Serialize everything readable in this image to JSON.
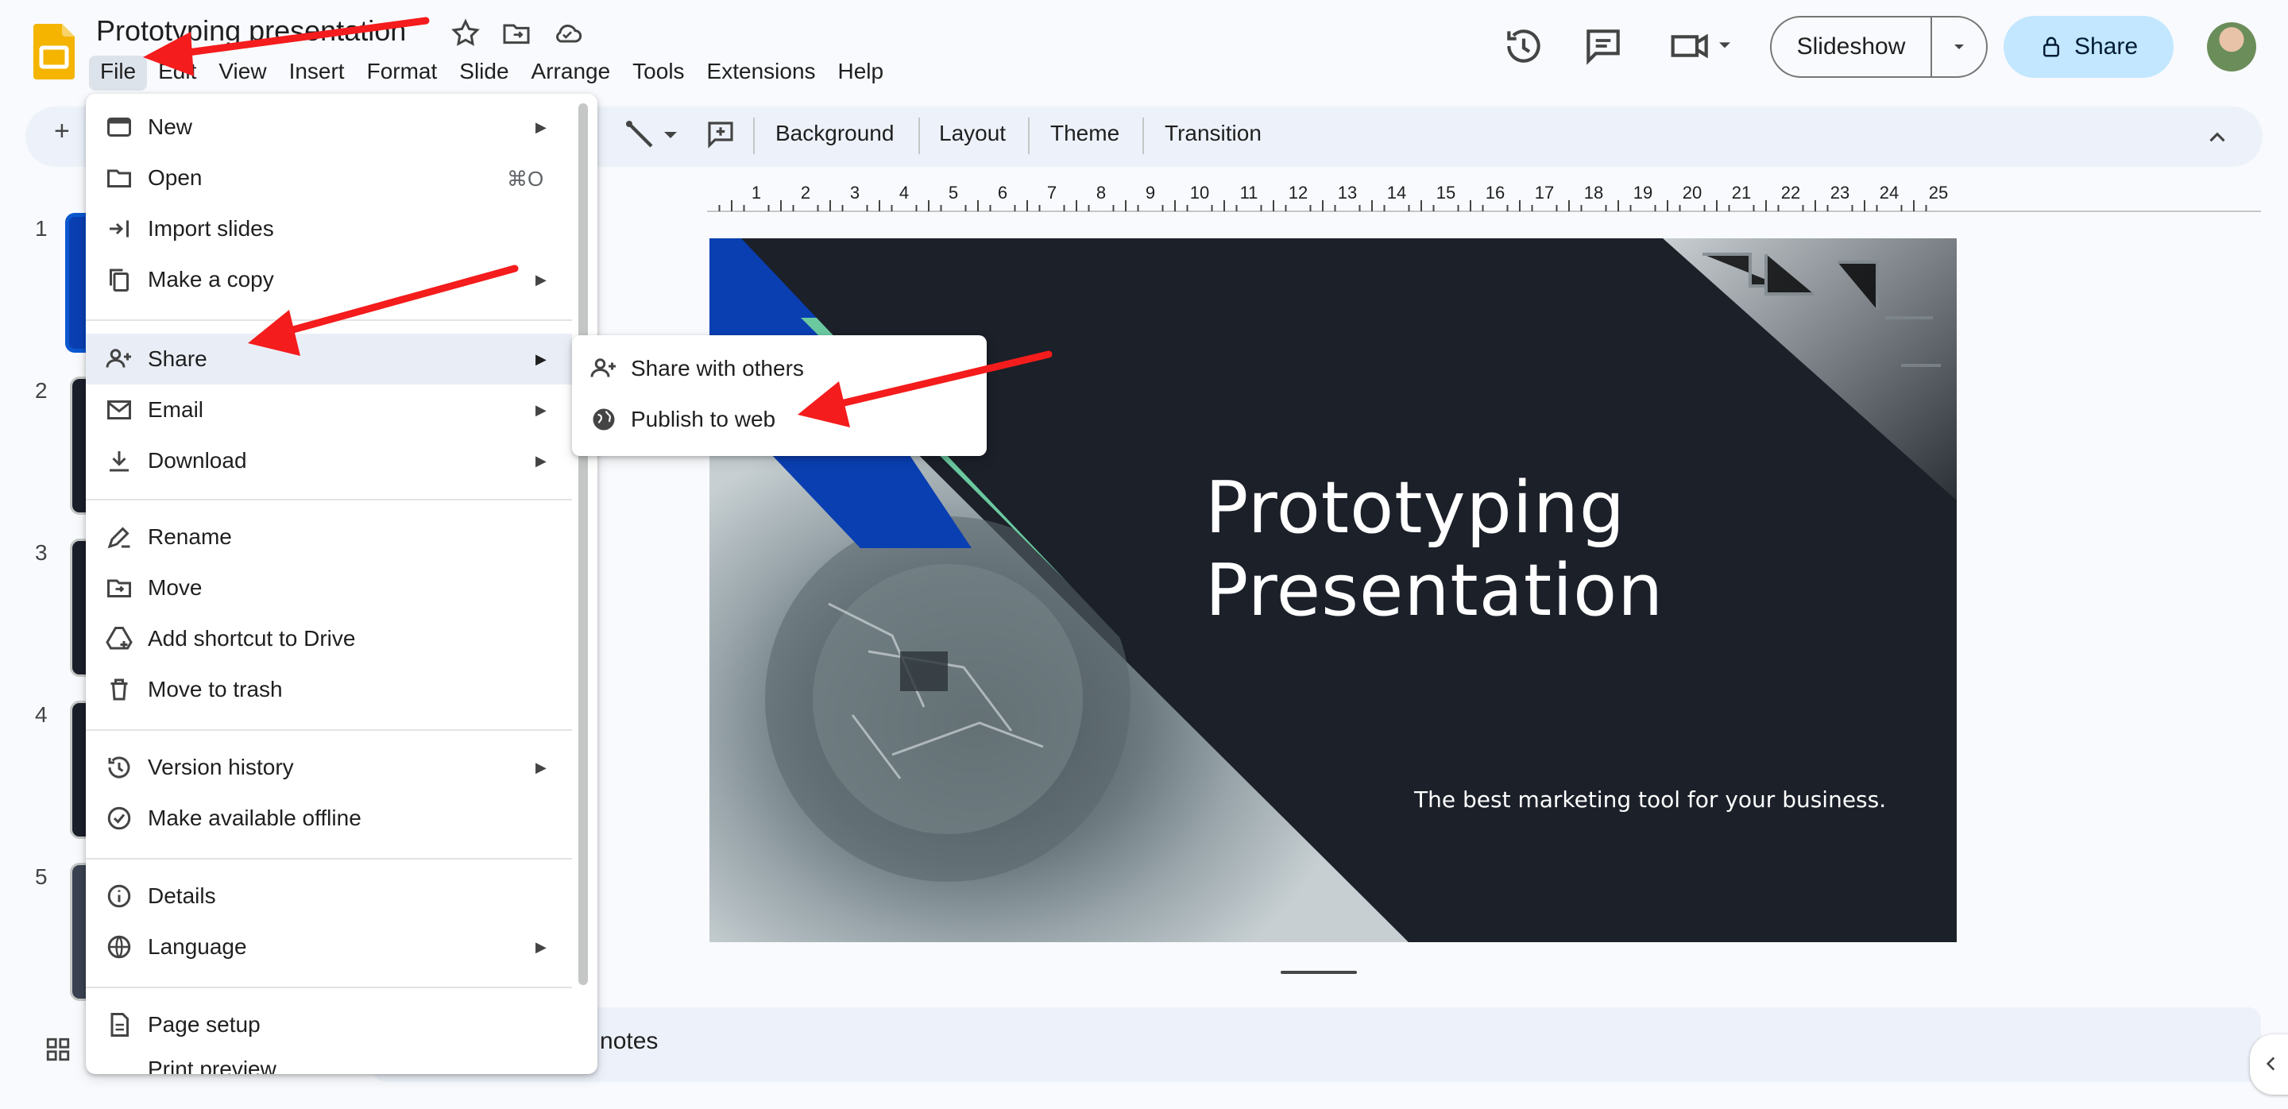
{
  "document": {
    "title": "Prototyping presentation"
  },
  "menubar": {
    "items": [
      "File",
      "Edit",
      "View",
      "Insert",
      "Format",
      "Slide",
      "Arrange",
      "Tools",
      "Extensions",
      "Help"
    ]
  },
  "header": {
    "slideshow_label": "Slideshow",
    "share_label": "Share"
  },
  "toolbar": {
    "background_label": "Background",
    "layout_label": "Layout",
    "theme_label": "Theme",
    "transition_label": "Transition"
  },
  "ruler": {
    "ticks": [
      "1",
      "2",
      "3",
      "4",
      "5",
      "6",
      "7",
      "8",
      "9",
      "10",
      "11",
      "12",
      "13",
      "14",
      "15",
      "16",
      "17",
      "18",
      "19",
      "20",
      "21",
      "22",
      "23",
      "24",
      "25"
    ]
  },
  "slides_panel": {
    "numbers": [
      "1",
      "2",
      "3",
      "4",
      "5"
    ]
  },
  "slide": {
    "title_line1": "Prototyping",
    "title_line2": "Presentation",
    "subtitle": "The best marketing tool for your business."
  },
  "notes": {
    "placeholder_visible": "er notes"
  },
  "file_menu": {
    "items": {
      "new": "New",
      "open": "Open",
      "open_shortcut": "⌘O",
      "import_slides": "Import slides",
      "make_copy": "Make a copy",
      "share": "Share",
      "email": "Email",
      "download": "Download",
      "rename": "Rename",
      "move": "Move",
      "add_shortcut": "Add shortcut to Drive",
      "move_to_trash": "Move to trash",
      "version_history": "Version history",
      "make_offline": "Make available offline",
      "details": "Details",
      "language": "Language",
      "page_setup": "Page setup",
      "print_preview_partial": "Print preview"
    }
  },
  "share_submenu": {
    "share_with_others": "Share with others",
    "publish_to_web": "Publish to web"
  },
  "colors": {
    "accent_blue": "#0b57d0",
    "share_button": "#c2e7ff",
    "slide_dark": "#1b2029",
    "slide_green": "#6bc9a0",
    "slide_blue": "#0a3fb2",
    "annotation_red": "#f41c1c"
  },
  "icons": [
    "slides-logo",
    "star-icon",
    "move-folder-icon",
    "cloud-icon",
    "history-icon",
    "comment-icon",
    "meet-icon",
    "lock-icon",
    "chevron-down-icon",
    "chevron-up-icon",
    "grid-icon"
  ]
}
